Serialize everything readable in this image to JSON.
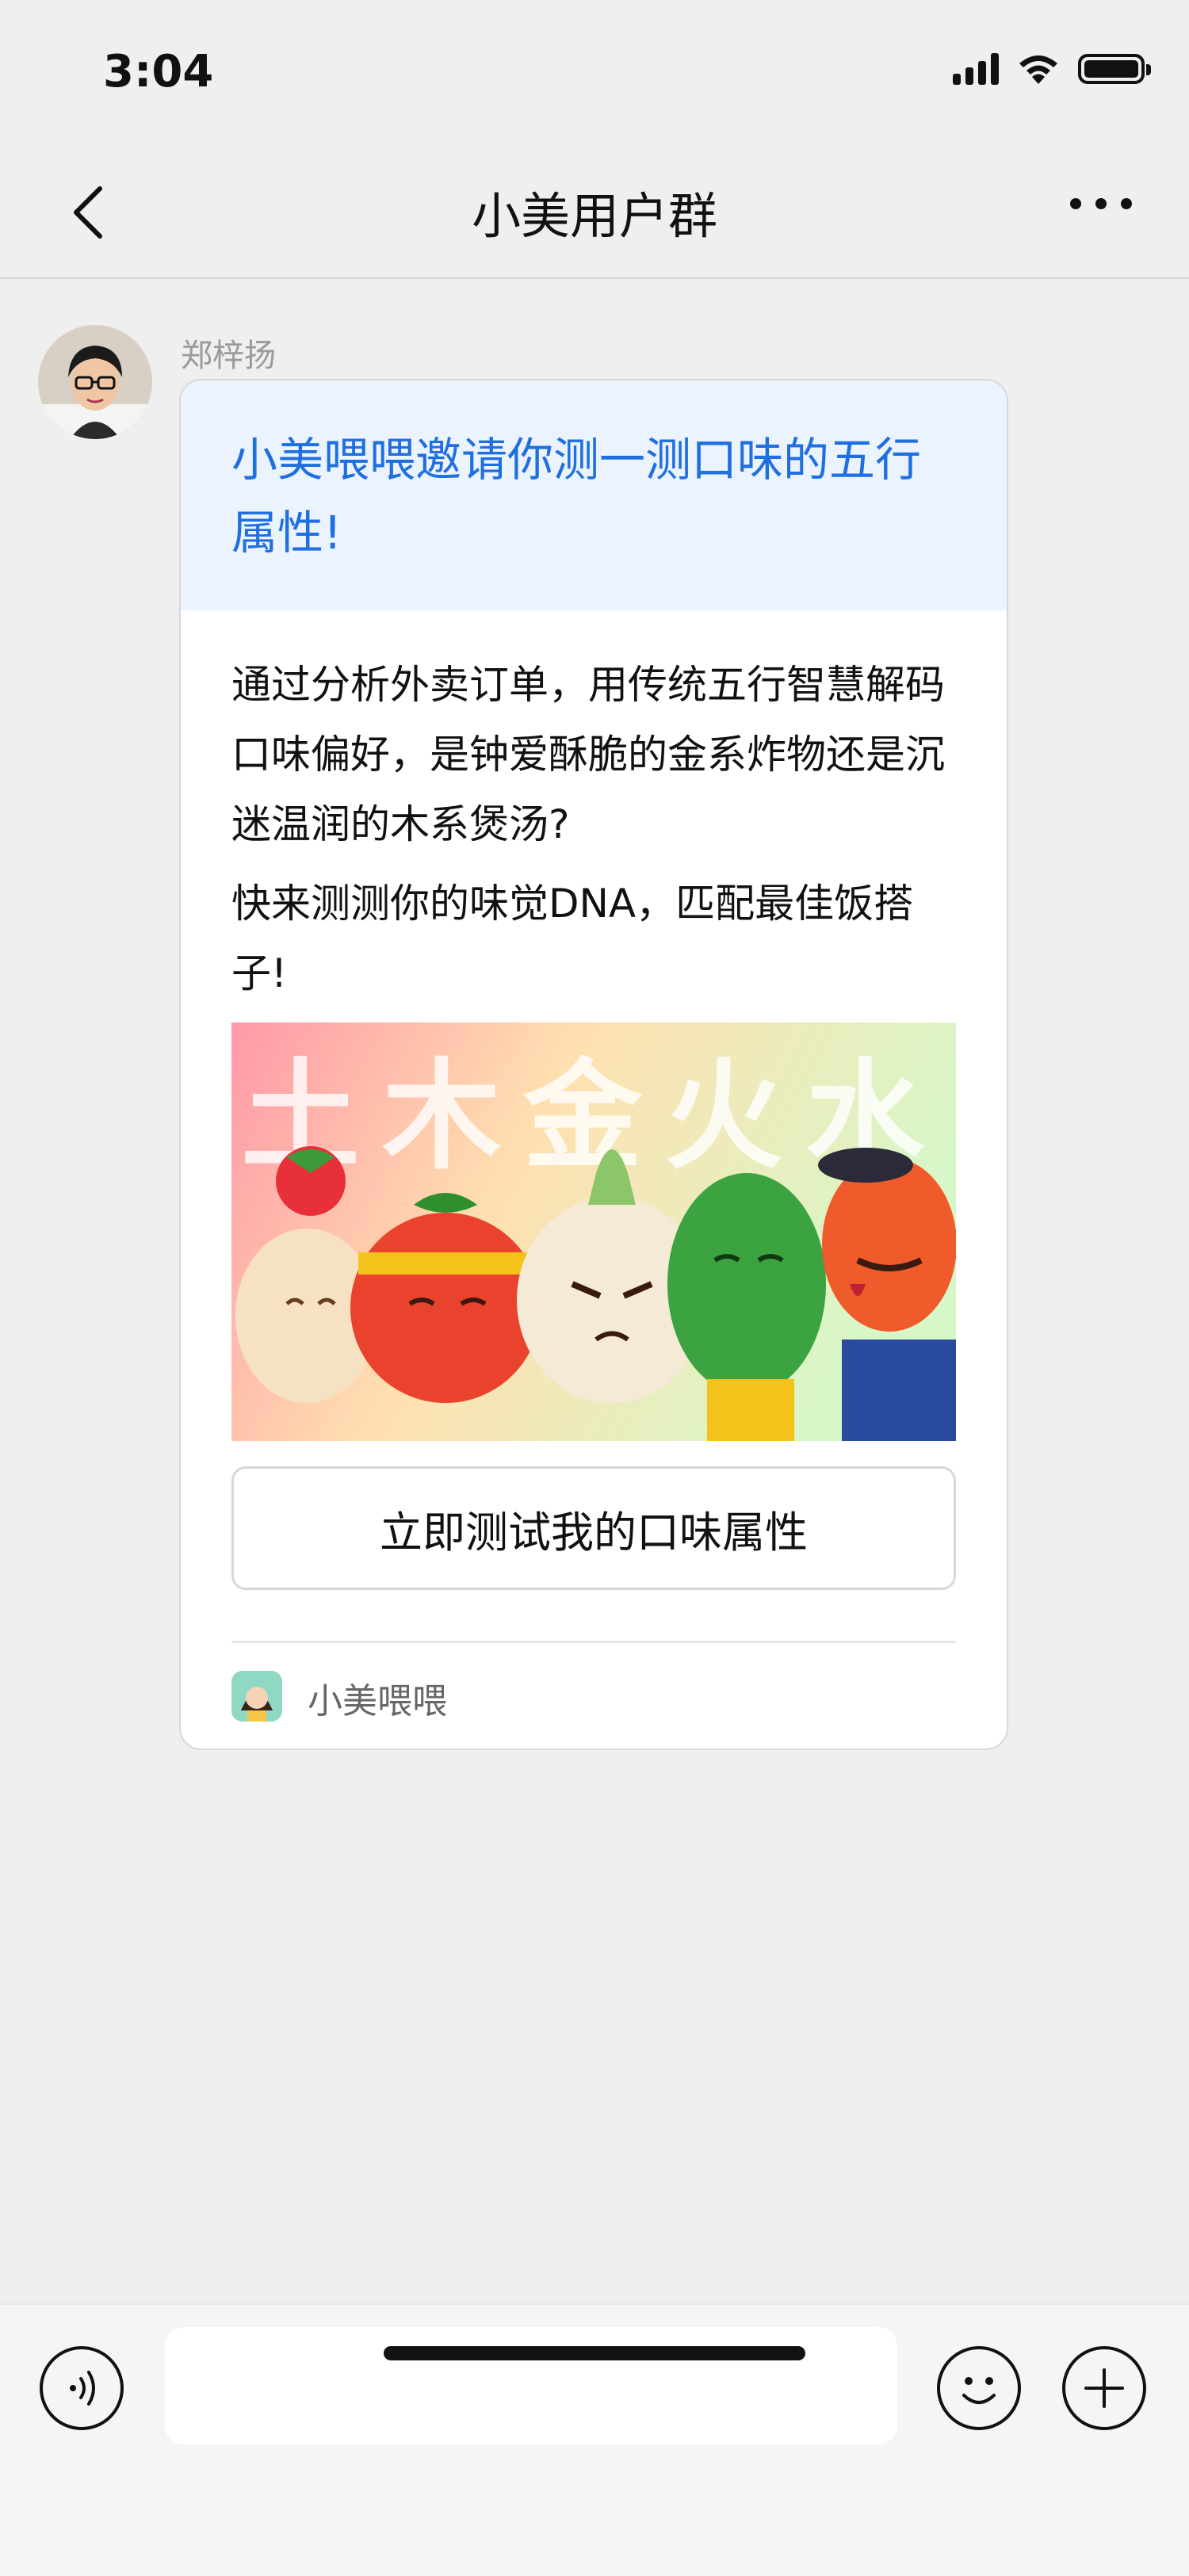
{
  "status_bar": {
    "time": "3:04"
  },
  "nav": {
    "title": "小美用户群"
  },
  "message": {
    "sender": "郑梓扬",
    "card": {
      "title": "小美喂喂邀请你测一测口味的五行属性!",
      "body_1": "通过分析外卖订单，用传统五行智慧解码口味偏好，是钟爱酥脆的金系炸物还是沉迷温润的木系煲汤?",
      "body_2": "快来测测你的味觉DNA，匹配最佳饭搭子!",
      "banner_text": "土木金火水",
      "cta_label": "立即测试我的口味属性",
      "brand": "小美喂喂"
    }
  },
  "colors": {
    "accent": "#1f6fe0",
    "card_head_bg": "#eaf3fe",
    "page_bg": "#efefef"
  },
  "icons": [
    "back-chevron-icon",
    "more-dots-icon",
    "voice-icon",
    "emoji-icon",
    "plus-icon",
    "signal-icon",
    "wifi-icon",
    "battery-icon"
  ]
}
